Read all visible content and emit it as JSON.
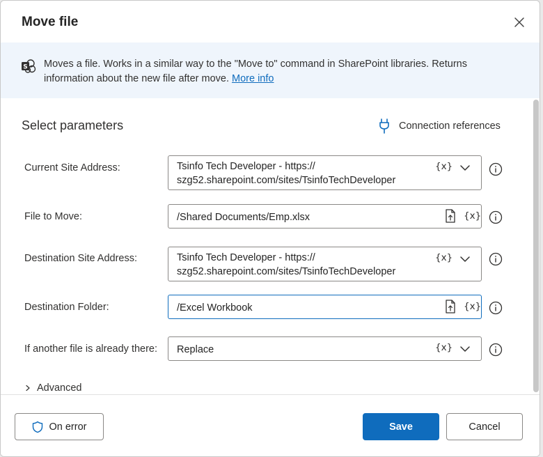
{
  "dialog": {
    "title": "Move file",
    "info": {
      "text": "Moves a file. Works in a similar way to the \"Move to\" command in SharePoint libraries. Returns information about the new file after move.",
      "link": "More info"
    },
    "section_title": "Select parameters",
    "connection_references": "Connection references",
    "fields": {
      "current_site": {
        "label": "Current Site Address:",
        "value_line1": "Tsinfo Tech Developer - https://",
        "value_line2": "szg52.sharepoint.com/sites/TsinfoTechDeveloper"
      },
      "file_to_move": {
        "label": "File to Move:",
        "value": "/Shared Documents/Emp.xlsx"
      },
      "destination_site": {
        "label": "Destination Site Address:",
        "value_line1": "Tsinfo Tech Developer - https://",
        "value_line2": "szg52.sharepoint.com/sites/TsinfoTechDeveloper"
      },
      "destination_folder": {
        "label": "Destination Folder:",
        "value": "/Excel Workbook"
      },
      "if_exists": {
        "label": "If another file is already there:",
        "value": "Replace"
      }
    },
    "variable_token": "{x}",
    "advanced": "Advanced",
    "footer": {
      "on_error": "On error",
      "save": "Save",
      "cancel": "Cancel"
    }
  },
  "colors": {
    "accent": "#0f6cbd",
    "info_bg": "#eff5fc",
    "border": "#8a8886"
  },
  "icons": [
    "close-icon",
    "sharepoint-icon",
    "plug-icon",
    "chevron-down-icon",
    "file-upload-icon",
    "info-icon",
    "chevron-right-icon",
    "shield-icon"
  ]
}
